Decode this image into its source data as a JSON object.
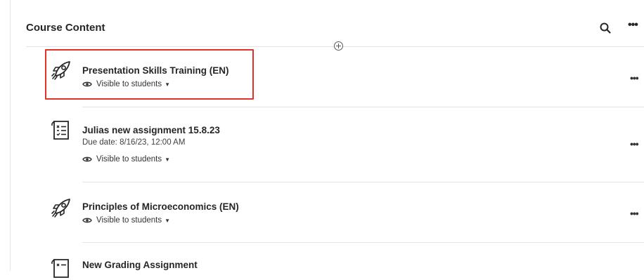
{
  "header": {
    "title": "Course Content",
    "search_icon": "search-icon",
    "more_icon": "more-options-icon"
  },
  "add_icon": "add-content-icon",
  "items": [
    {
      "title": "Presentation Skills Training (EN)",
      "icon": "rocket-icon",
      "visibility": "Visible to students",
      "highlighted": true
    },
    {
      "title": "Julias new assignment 15.8.23",
      "icon": "assignment-icon",
      "due": "Due date: 8/16/23, 12:00 AM",
      "visibility": "Visible to students"
    },
    {
      "title": "Principles of Microeconomics (EN)",
      "icon": "rocket-icon",
      "visibility": "Visible to students"
    },
    {
      "title": "New Grading Assignment",
      "icon": "assignment-icon"
    }
  ],
  "colors": {
    "highlight": "#e0322a",
    "text": "#262626",
    "divider": "#e3e3e3"
  }
}
